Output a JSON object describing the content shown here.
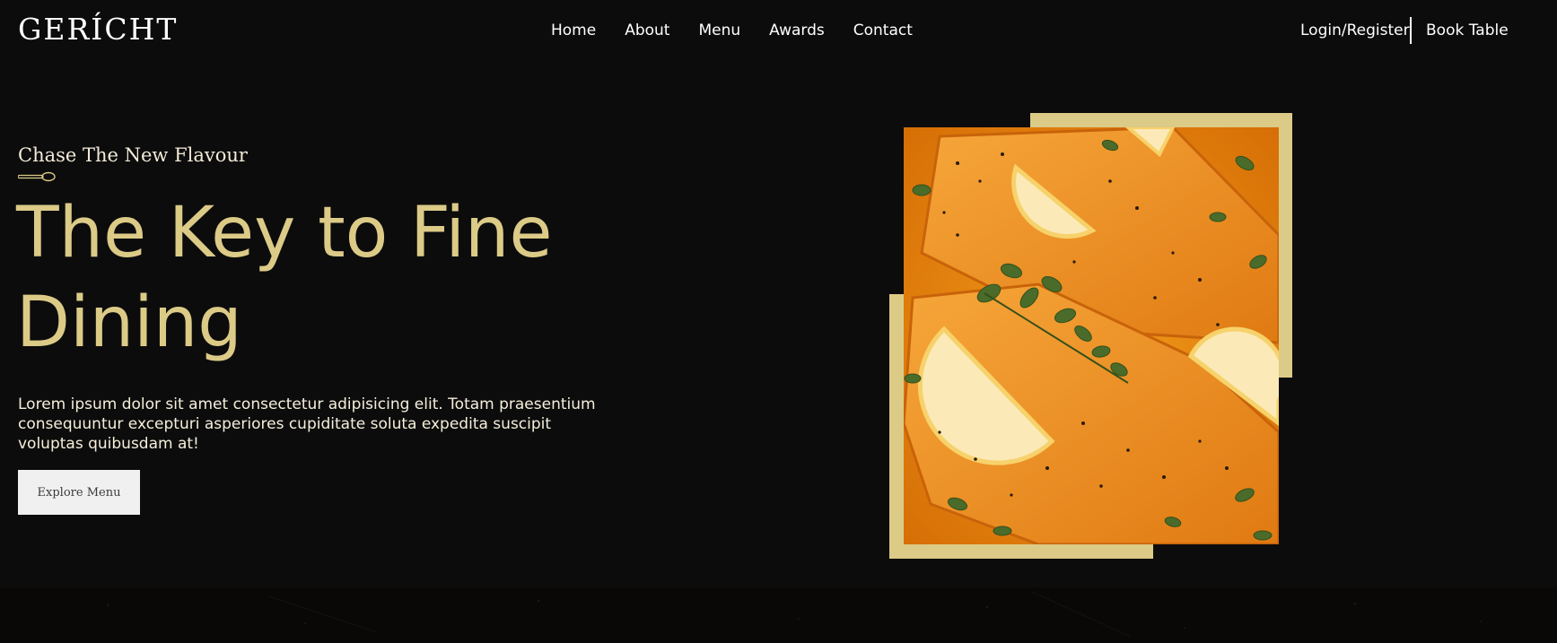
{
  "brand": {
    "logo": "GERÍCHT"
  },
  "nav": {
    "links": [
      "Home",
      "About",
      "Menu",
      "Awards",
      "Contact"
    ],
    "login": "Login/Register",
    "book": "Book Table"
  },
  "hero": {
    "subtitle": "Chase The New Flavour",
    "headline": "The Key to Fine Dining",
    "description": "Lorem ipsum dolor sit amet consectetur adipisicing elit. Totam praesentium consequuntur excepturi asperiores cupiditate soluta expedita suscipit voluptas quibusdam at!",
    "button": "Explore Menu"
  },
  "colors": {
    "background": "#0c0c0c",
    "gold": "#dcca87",
    "text_light": "#f5efdb",
    "button_bg": "#f0f0f0",
    "food_orange": "#e8870c"
  },
  "icons": {
    "spoon": "spoon-icon"
  }
}
